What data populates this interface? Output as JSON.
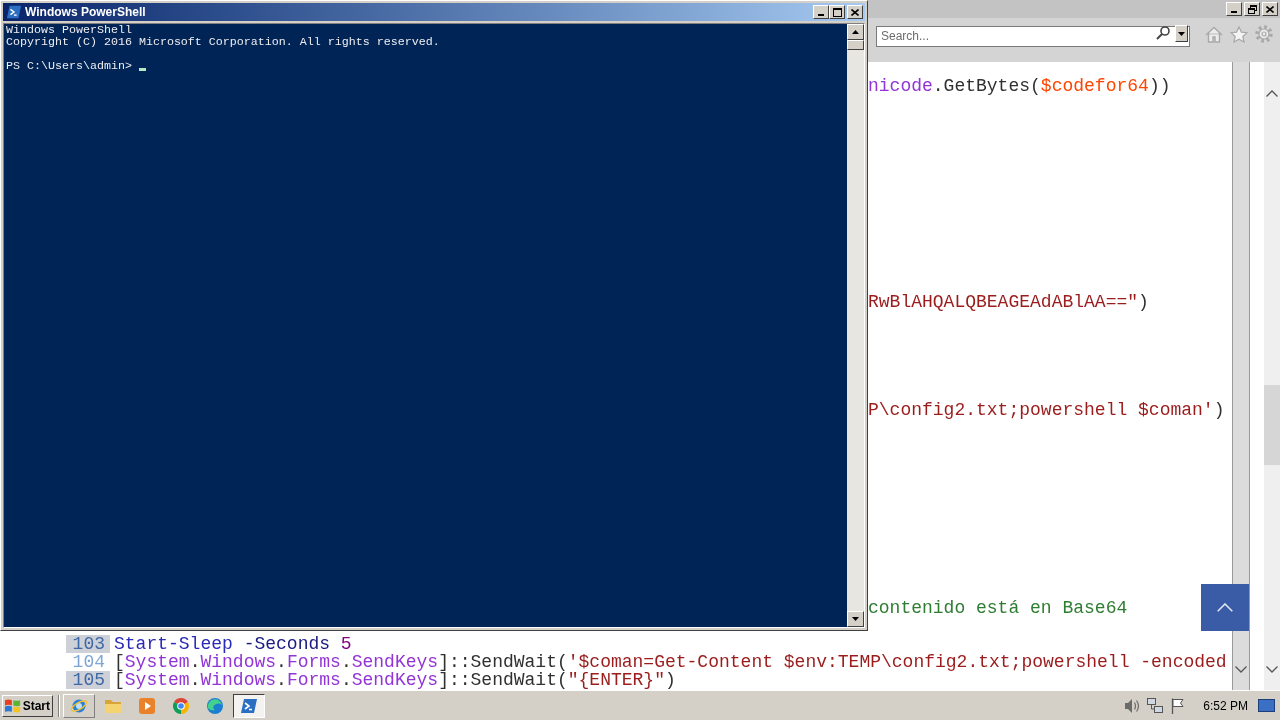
{
  "powershell_window": {
    "title": "Windows PowerShell",
    "banner": [
      "Windows PowerShell",
      "Copyright (C) 2016 Microsoft Corporation. All rights reserved."
    ],
    "prompt": "PS C:\\Users\\admin>"
  },
  "browser": {
    "search": {
      "placeholder": "Search..."
    },
    "code_fragments": [
      {
        "tokens": [
          {
            "kind": "type",
            "text": "nicode"
          },
          {
            "kind": "plain",
            "text": ".GetBytes("
          },
          {
            "kind": "variable",
            "text": "$codefor64"
          },
          {
            "kind": "plain",
            "text": "))"
          }
        ]
      },
      {
        "tokens": [
          {
            "kind": "string",
            "text": "RwBlAHQALQBEAGEAdABlAA==\""
          },
          {
            "kind": "plain",
            "text": ")"
          }
        ]
      },
      {
        "tokens": [
          {
            "kind": "string",
            "text": "P\\config2.txt;powershell $coman'"
          },
          {
            "kind": "plain",
            "text": ")"
          }
        ]
      },
      {
        "tokens": [
          {
            "kind": "comment",
            "text": "contenido está en Base64"
          }
        ]
      }
    ],
    "code_lines": [
      {
        "number": "103",
        "shaded": true,
        "tokens": [
          {
            "kind": "cmdlet",
            "text": "Start-Sleep"
          },
          {
            "kind": "parameter",
            "text": " -Seconds"
          },
          {
            "kind": "number",
            "text": " 5"
          }
        ]
      },
      {
        "number": "104",
        "shaded": false,
        "tokens": [
          {
            "kind": "plain",
            "text": "["
          },
          {
            "kind": "type",
            "text": "System"
          },
          {
            "kind": "plain",
            "text": "."
          },
          {
            "kind": "type",
            "text": "Windows"
          },
          {
            "kind": "plain",
            "text": "."
          },
          {
            "kind": "type",
            "text": "Forms"
          },
          {
            "kind": "plain",
            "text": "."
          },
          {
            "kind": "type",
            "text": "SendKeys"
          },
          {
            "kind": "plain",
            "text": "]::SendWait("
          },
          {
            "kind": "string",
            "text": "'$coman=Get-Content $env:TEMP\\config2.txt;powershell -encoded"
          }
        ]
      },
      {
        "number": "105",
        "shaded": true,
        "tokens": [
          {
            "kind": "plain",
            "text": "["
          },
          {
            "kind": "type",
            "text": "System"
          },
          {
            "kind": "plain",
            "text": "."
          },
          {
            "kind": "type",
            "text": "Windows"
          },
          {
            "kind": "plain",
            "text": "."
          },
          {
            "kind": "type",
            "text": "Forms"
          },
          {
            "kind": "plain",
            "text": "."
          },
          {
            "kind": "type",
            "text": "SendKeys"
          },
          {
            "kind": "plain",
            "text": "]::SendWait("
          },
          {
            "kind": "string",
            "text": "\"{ENTER}\""
          },
          {
            "kind": "plain",
            "text": ")"
          }
        ]
      }
    ]
  },
  "taskbar": {
    "start": "Start",
    "items": [
      {
        "kind": "ie",
        "selected": false,
        "hovered": true
      },
      {
        "kind": "folder",
        "selected": false,
        "hovered": false
      },
      {
        "kind": "media",
        "selected": false,
        "hovered": false
      },
      {
        "kind": "chrome",
        "selected": false,
        "hovered": false
      },
      {
        "kind": "edge",
        "selected": false,
        "hovered": false
      },
      {
        "kind": "powershell",
        "selected": true,
        "hovered": false
      }
    ],
    "clock": "6:52 PM"
  }
}
